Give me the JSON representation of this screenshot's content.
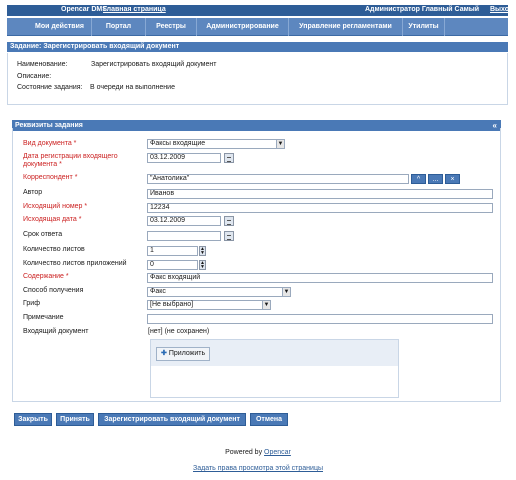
{
  "topbar": {
    "app_name": "Opencar DMS",
    "home_link": "Главная страница",
    "user": "Администратор Главный Самый",
    "logout": "Выход"
  },
  "menu": {
    "items": [
      {
        "label": "Мои действия"
      },
      {
        "label": "Портал"
      },
      {
        "label": "Реестры"
      },
      {
        "label": "Администрирование"
      },
      {
        "label": "Управление регламентами"
      },
      {
        "label": "Утилиты"
      }
    ]
  },
  "task": {
    "header": "Задание: Зарегистрировать входящий документ",
    "name_label": "Наименование:",
    "name_value": "Зарегистрировать входящий документ",
    "description_label": "Описание:",
    "state_label": "Состояние задания:",
    "state_value": "В очереди на выполнение"
  },
  "details": {
    "header": "Реквизиты задания",
    "collapse": "«",
    "fields": {
      "doc_type": {
        "label": "Вид документа *",
        "value": "Факсы входящие"
      },
      "reg_date": {
        "label": "Дата регистрации входящего документа *",
        "value": "03.12.2009"
      },
      "correspondent": {
        "label": "Корреспондент *",
        "value": "\"Анатолика\""
      },
      "author": {
        "label": "Автор",
        "value": "Иванов"
      },
      "out_number": {
        "label": "Исходящий номер *",
        "value": "12234"
      },
      "out_date": {
        "label": "Исходящая дата *",
        "value": "03.12.2009"
      },
      "due_date": {
        "label": "Срок ответа",
        "value": ""
      },
      "sheets": {
        "label": "Количество листов",
        "value": "1"
      },
      "attach_sheets": {
        "label": "Количество листов приложений",
        "value": "0"
      },
      "content": {
        "label": "Содержание *",
        "value": "Факс входящий"
      },
      "receive_method": {
        "label": "Способ получения",
        "value": "Факс"
      },
      "stamp": {
        "label": "Гриф",
        "value": "[Не выбрано]"
      },
      "note": {
        "label": "Примечание",
        "value": ""
      },
      "incoming_doc": {
        "label": "Входящий документ",
        "value": "[нет] (не сохранен)"
      }
    },
    "corr_buttons": [
      "^",
      "...",
      "×"
    ],
    "attach_button": "Приложить"
  },
  "actions": {
    "close": "Закрыть",
    "accept": "Принять",
    "register": "Зарегистрировать входящий документ",
    "cancel": "Отмена"
  },
  "footer": {
    "powered_by": "Powered by",
    "powered_link": "Opencar",
    "rights_link": "Задать права просмотра этой страницы"
  },
  "colors": {
    "topbar": "#2e5d97",
    "menubar": "#5d87bf",
    "header": "#4a79b6",
    "required_label": "#cc2222"
  }
}
